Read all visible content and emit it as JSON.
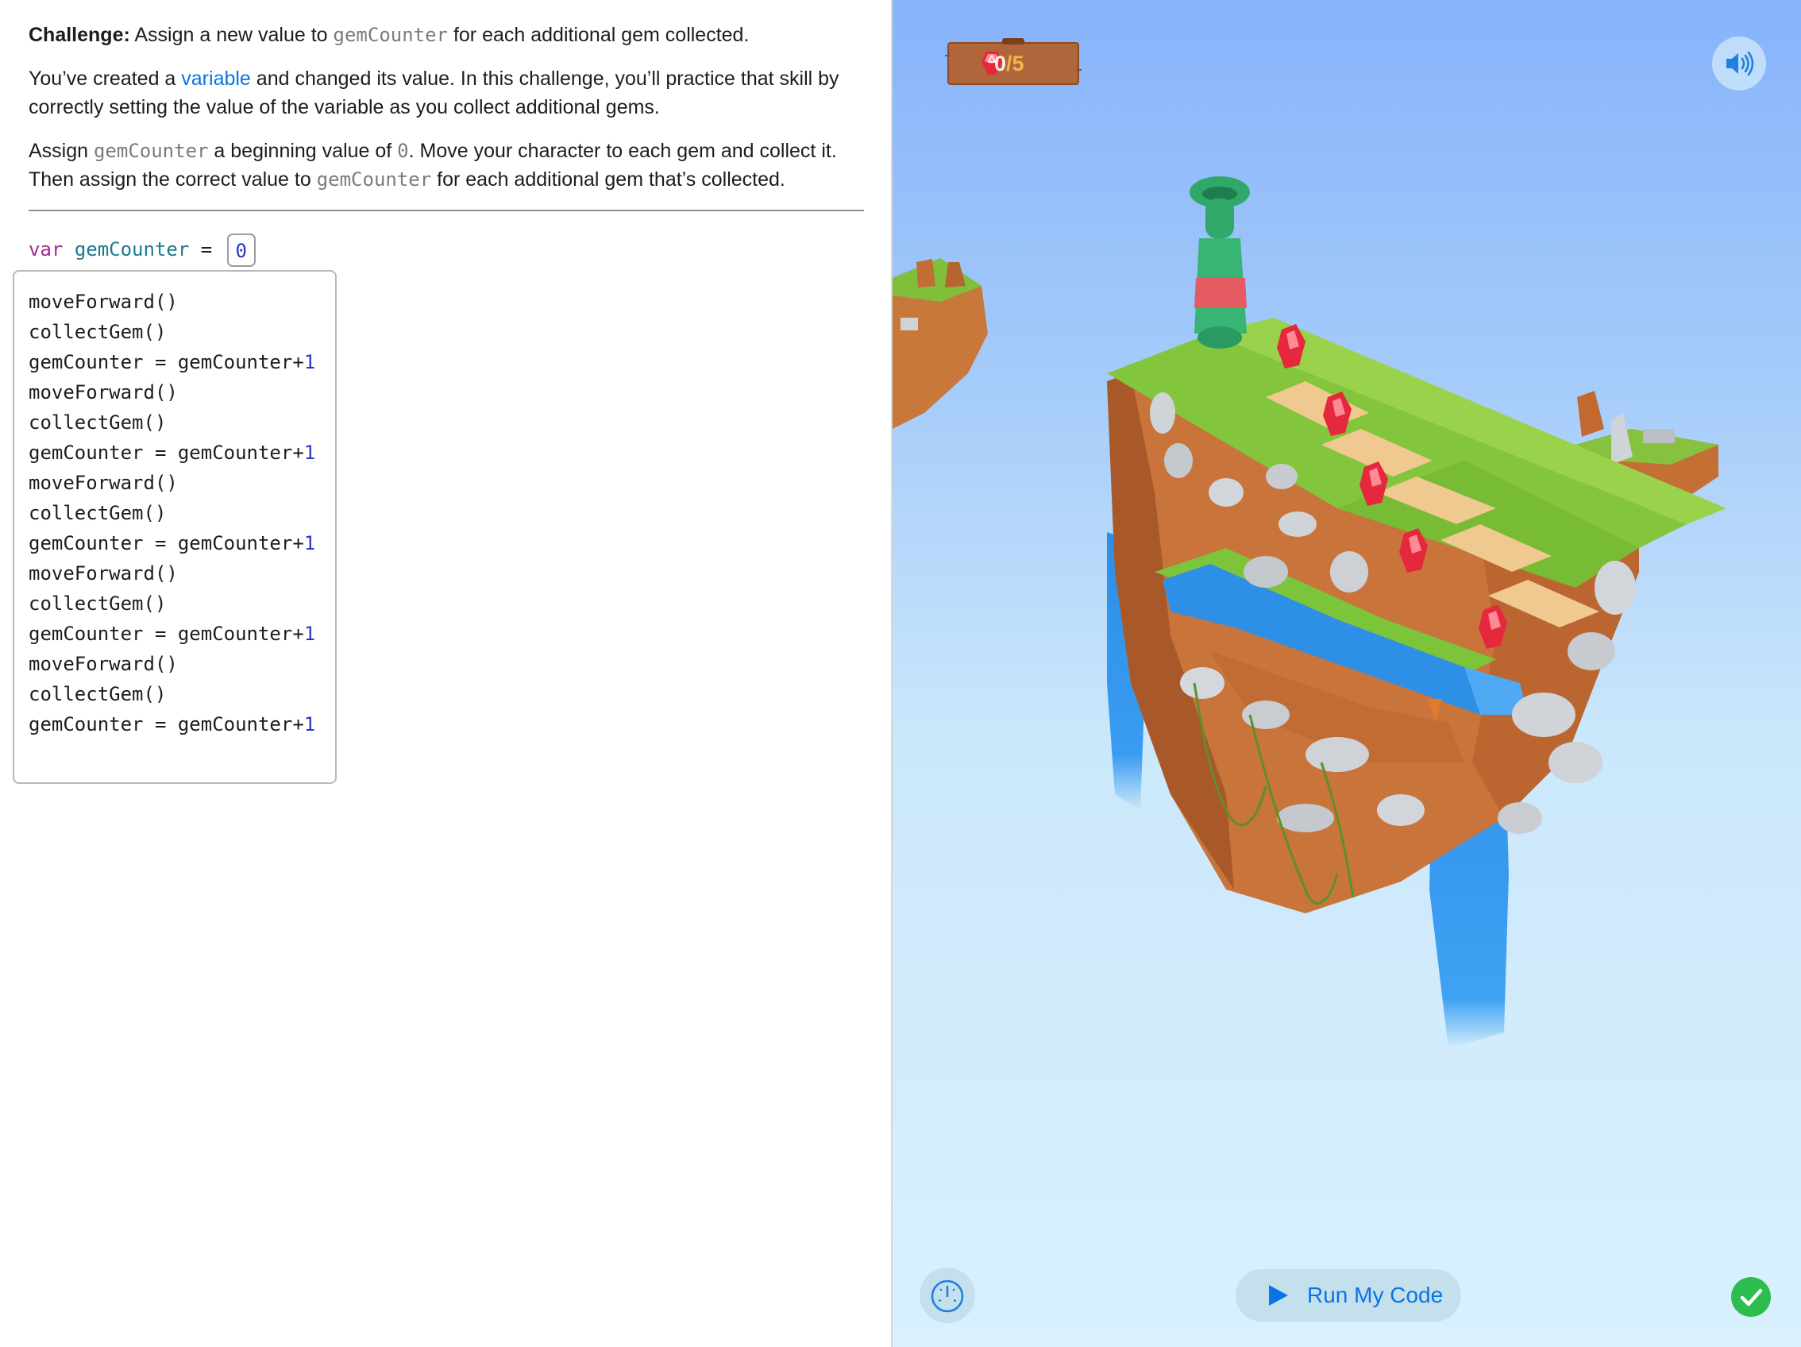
{
  "instructions": {
    "challenge_label": "Challenge:",
    "challenge_text_1": " Assign a new value to ",
    "challenge_code": "gemCounter",
    "challenge_text_2": " for each additional gem collected.",
    "p2_text_1": "You’ve created a ",
    "p2_link": "variable",
    "p2_text_2": " and changed its value. In this challenge, you’ll practice that skill by correctly setting the value of the variable as you collect additional gems.",
    "p3_text_1": "Assign ",
    "p3_code_1": "gemCounter",
    "p3_text_2": " a beginning value of ",
    "p3_code_2": "0",
    "p3_text_3": ". Move your character to each gem and collect it. Then assign the correct value to ",
    "p3_code_3": "gemCounter",
    "p3_text_4": " for each additional gem that’s collected."
  },
  "declaration": {
    "keyword": "var",
    "name": "gemCounter",
    "operator": "=",
    "value": "0"
  },
  "code_lines": [
    "moveForward()",
    "collectGem()",
    "gemCounter = gemCounter+",
    "moveForward()",
    "collectGem()",
    "gemCounter = gemCounter+",
    "moveForward()",
    "collectGem()",
    "gemCounter = gemCounter+",
    "moveForward()",
    "collectGem()",
    "gemCounter = gemCounter+",
    "moveForward()",
    "collectGem()",
    "gemCounter = gemCounter+"
  ],
  "code_numbers": [
    "1",
    "1",
    "1",
    "1",
    "1"
  ],
  "game": {
    "gems_collected": "0",
    "gems_total": "/5",
    "run_button_label": "Run My Code"
  },
  "colors": {
    "link": "#0a74e6",
    "keyword": "#a52a92",
    "identifier": "#1b7b8f",
    "number": "#2a35c4",
    "success": "#2dbc4e",
    "sign_wood": "#b0663a"
  },
  "icons": {
    "sign_gem": "gem-icon",
    "sound": "speaker-icon",
    "speed": "speedometer-icon",
    "run": "play-icon",
    "status": "checkmark-icon"
  }
}
